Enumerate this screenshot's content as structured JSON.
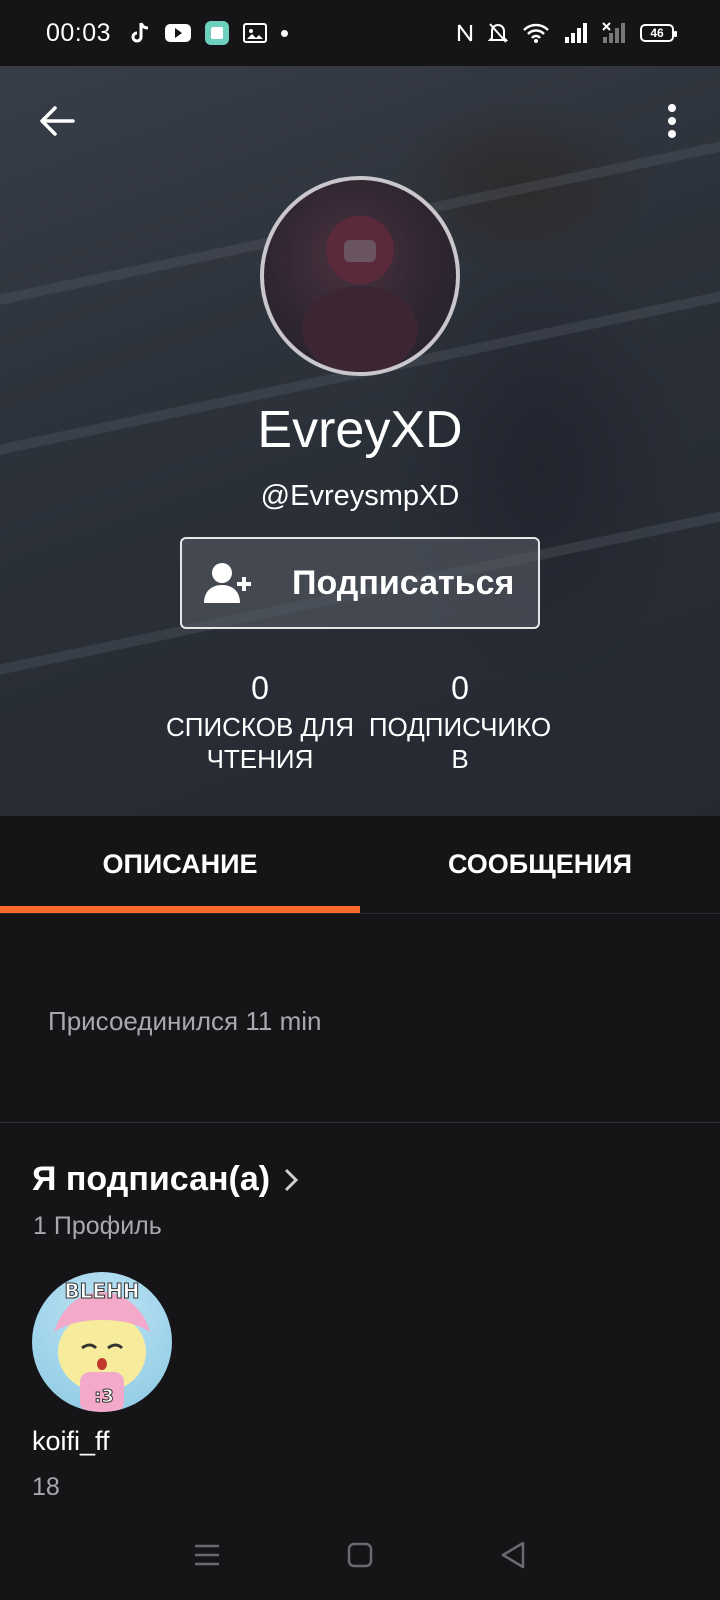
{
  "status_bar": {
    "time": "00:03",
    "battery": "46",
    "left_icons": [
      "tiktok-icon",
      "youtube-icon",
      "app-icon",
      "gallery-icon",
      "dot-icon"
    ],
    "right_icons": [
      "nfc-icon",
      "bell-off-icon",
      "wifi-icon",
      "signal-icon",
      "signal-no-sim-icon",
      "battery-icon"
    ]
  },
  "profile": {
    "display_name": "EvreyXD",
    "username": "@EvreysmpXD",
    "follow_label": "Подписаться",
    "stats": [
      {
        "value": "0",
        "label": "СПИСКОВ ДЛЯ ЧТЕНИЯ"
      },
      {
        "value": "0",
        "label": "ПОДПИСЧИКО В"
      }
    ]
  },
  "tabs": [
    {
      "label": "ОПИСАНИЕ",
      "active": true
    },
    {
      "label": "СООБЩЕНИЯ",
      "active": false
    }
  ],
  "about": {
    "joined": "Присоединился 11 min"
  },
  "following": {
    "title": "Я подписан(а)",
    "count": "1 Профиль",
    "users": [
      {
        "name": "koifi_ff",
        "number": "18",
        "avatar_text_top": "BLEHH",
        "avatar_text_bottom": ":3"
      }
    ]
  },
  "colors": {
    "accent": "#ff6a2b",
    "background": "#151417",
    "muted_text": "#a9a8ad"
  }
}
